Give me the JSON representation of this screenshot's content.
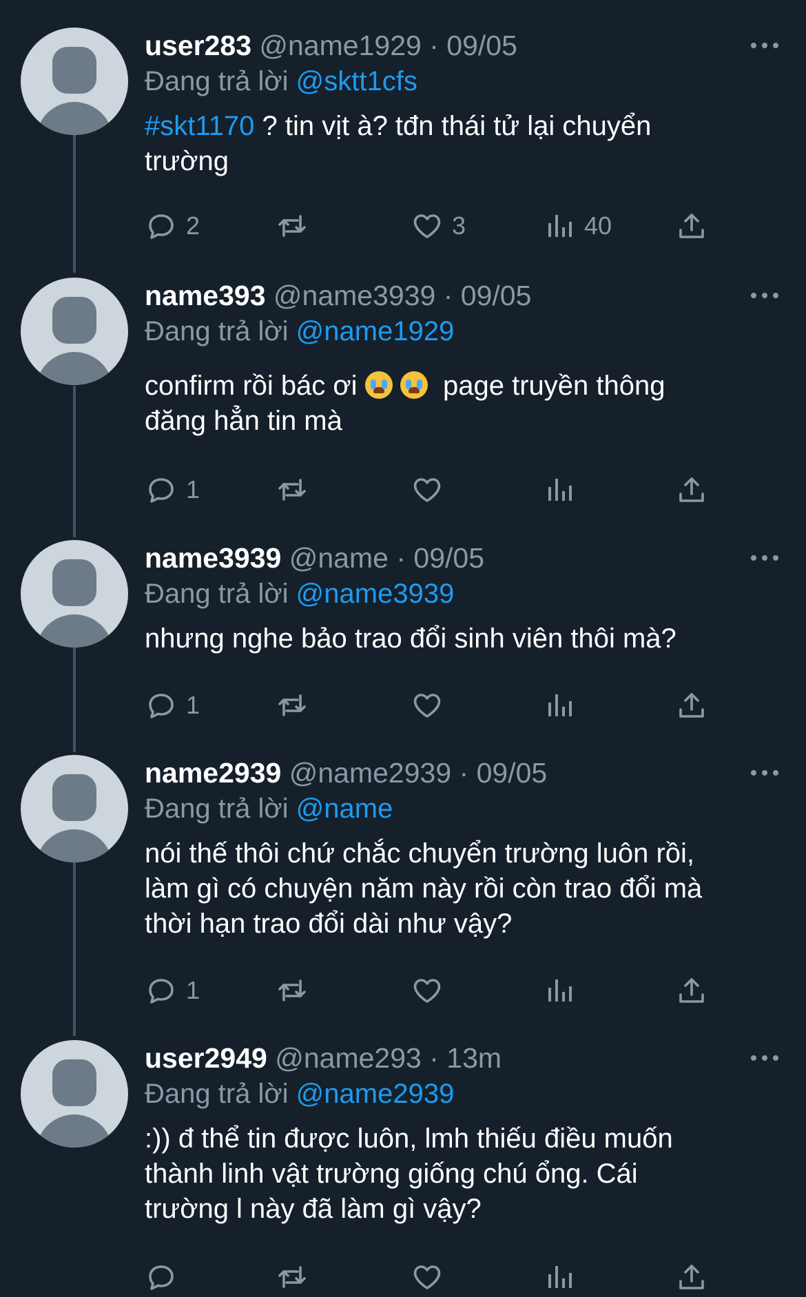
{
  "tweets": [
    {
      "display_name": "user283",
      "handle": "@name1929",
      "time": "09/05",
      "replying_prefix": "Đang trả lời",
      "replying_to": "@sktt1cfs",
      "hashtag": "#skt1170",
      "text": " ? tin vịt à? tđn thái tử lại chuyển\ntrường",
      "replies": "2",
      "retweets": "",
      "likes": "3",
      "views": "40"
    },
    {
      "display_name": "name393",
      "handle": "@name3939",
      "time": "09/05",
      "replying_prefix": "Đang trả lời",
      "replying_to": "@name1929",
      "text_before_emoji": "confirm rồi bác ơi ",
      "text_after_emoji": "  page truyền thông\nđăng hẳn tin mà",
      "emoji_name": "loudly-crying-face",
      "replies": "1",
      "retweets": "",
      "likes": "",
      "views": ""
    },
    {
      "display_name": "name3939",
      "handle": "@name",
      "time": "09/05",
      "replying_prefix": "Đang trả lời",
      "replying_to": "@name3939",
      "text": "nhưng nghe bảo trao đổi sinh viên thôi mà?",
      "replies": "1",
      "retweets": "",
      "likes": "",
      "views": ""
    },
    {
      "display_name": "name2939",
      "handle": "@name2939",
      "time": "09/05",
      "replying_prefix": "Đang trả lời",
      "replying_to": "@name",
      "text": "nói thế thôi chứ chắc chuyển trường luôn rồi,\nlàm gì có chuyện năm này rồi còn trao đổi mà\nthời hạn trao đổi dài như vậy?",
      "replies": "1",
      "retweets": "",
      "likes": "",
      "views": ""
    },
    {
      "display_name": "user2949",
      "handle": "@name293",
      "time": "13m",
      "replying_prefix": "Đang trả lời",
      "replying_to": "@name2939",
      "text": ":)) đ thể tin được luôn, lmh thiếu điều muốn\nthành linh vật trường giống chú ổng. Cái\ntrường l này đã làm gì vậy?",
      "replies": "",
      "retweets": "",
      "likes": "",
      "views": ""
    }
  ],
  "separator": "·",
  "colors": {
    "background": "#15202b",
    "text": "#ffffff",
    "muted": "#8b98a5",
    "link": "#1d9bf0",
    "thread_line": "#3d5466"
  },
  "icons": [
    "reply-icon",
    "retweet-icon",
    "like-icon",
    "views-icon",
    "share-icon",
    "more-icon"
  ]
}
